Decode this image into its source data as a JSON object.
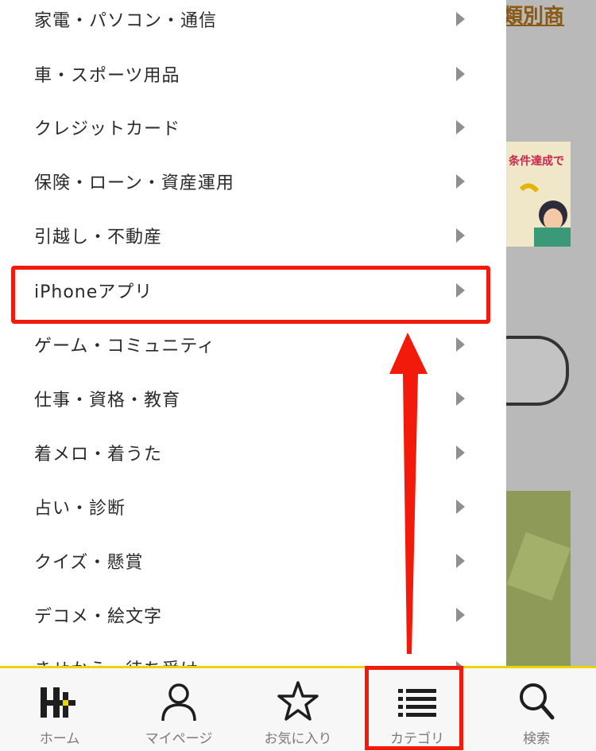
{
  "background": {
    "title_fragment": "類別商",
    "banner_text": "条件達成で"
  },
  "menu": {
    "items": [
      {
        "label": "家電・パソコン・通信"
      },
      {
        "label": "車・スポーツ用品"
      },
      {
        "label": "クレジットカード"
      },
      {
        "label": "保険・ローン・資産運用"
      },
      {
        "label": "引越し・不動産"
      },
      {
        "label": "iPhoneアプリ",
        "highlighted": true
      },
      {
        "label": "ゲーム・コミュニティ"
      },
      {
        "label": "仕事・資格・教育"
      },
      {
        "label": "着メロ・着うた"
      },
      {
        "label": "占い・診断"
      },
      {
        "label": "クイズ・懸賞"
      },
      {
        "label": "デコメ・絵文字"
      },
      {
        "label": "きせかえ・待ち受け"
      }
    ]
  },
  "tabbar": {
    "tabs": [
      {
        "label": "ホーム",
        "icon": "home-logo-icon"
      },
      {
        "label": "マイページ",
        "icon": "person-icon"
      },
      {
        "label": "お気に入り",
        "icon": "star-icon"
      },
      {
        "label": "カテゴリ",
        "icon": "list-icon",
        "highlighted": true
      },
      {
        "label": "検索",
        "icon": "search-icon"
      }
    ]
  },
  "colors": {
    "highlight": "#f21a0a",
    "brand_yellow": "#e9d600"
  }
}
